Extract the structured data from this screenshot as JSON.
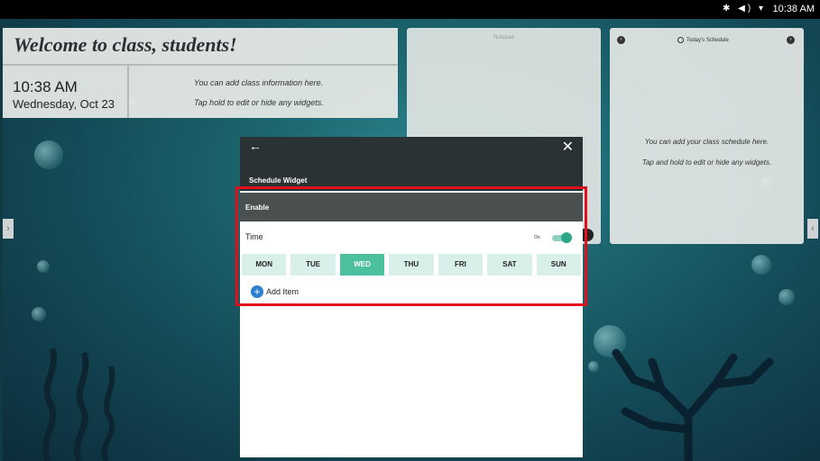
{
  "status_bar": {
    "icons": [
      "bluetooth-icon",
      "volume-icon",
      "wifi-icon"
    ],
    "clock": "10:38 AM"
  },
  "welcome_widget": {
    "title": "Welcome to class, students!",
    "time": "10:38 AM",
    "date": "Wednesday, Oct 23",
    "info_line1": "You can add class information here.",
    "info_line2": "Tap hold to edit or hide any widgets."
  },
  "notepad_widget": {
    "title": "Notepad"
  },
  "schedule_card": {
    "title": "Today's Schedule",
    "line1": "You can add your class schedule here.",
    "line2": "Tap and hold to edit or hide any widgets."
  },
  "dialog": {
    "title": "Schedule Widget",
    "enable_label": "Enable",
    "time_label": "Time",
    "toggle_state": "On",
    "days": [
      "MON",
      "TUE",
      "WED",
      "THU",
      "FRI",
      "SAT",
      "SUN"
    ],
    "selected_day": "WED",
    "add_item_label": "Add Item"
  },
  "colors": {
    "accent": "#4cbf9f",
    "highlight": "#e0101a",
    "dialog_header": "#2a3234"
  }
}
